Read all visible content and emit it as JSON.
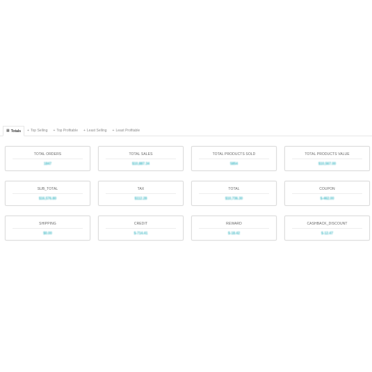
{
  "tabs": [
    {
      "label": "Totals",
      "icon": "table-icon",
      "active": true
    },
    {
      "label": "Top Selling",
      "icon": "plus-icon",
      "active": false
    },
    {
      "label": "Top Profitable",
      "icon": "plus-icon",
      "active": false
    },
    {
      "label": "Least Selling",
      "icon": "plus-icon",
      "active": false
    },
    {
      "label": "Least Profitable",
      "icon": "plus-icon",
      "active": false
    }
  ],
  "cards": [
    {
      "title": "TOTAL ORDERS",
      "value": "1847"
    },
    {
      "title": "TOTAL SALES",
      "value": "$10,887.34"
    },
    {
      "title": "TOTAL PRODUCTS SOLD",
      "value": "5854"
    },
    {
      "title": "TOTAL PRODUCTS VALUE",
      "value": "$10,567.00"
    },
    {
      "title": "SUB_TOTAL",
      "value": "$16,576.80"
    },
    {
      "title": "TAX",
      "value": "$112.28"
    },
    {
      "title": "TOTAL",
      "value": "$10,736.30"
    },
    {
      "title": "COUPON",
      "value": "$-462.00"
    },
    {
      "title": "SHIPPING",
      "value": "$0.00"
    },
    {
      "title": "CREDIT",
      "value": "$-714.41"
    },
    {
      "title": "REWARD",
      "value": "$-18.42"
    },
    {
      "title": "CASHBACK_DISCOUNT",
      "value": "$-12.47"
    }
  ],
  "colors": {
    "value_accent": "#3fb8c4",
    "card_border": "#dcdcdc",
    "title_text": "#666666"
  }
}
